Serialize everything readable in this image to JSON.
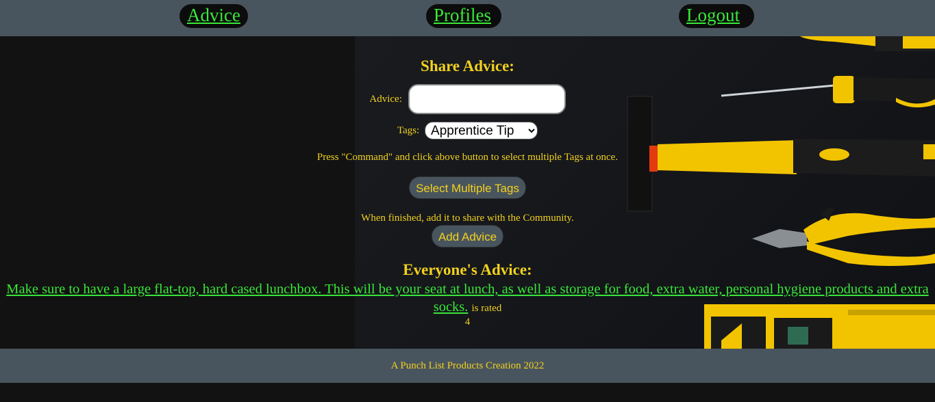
{
  "nav": {
    "advice": "Advice",
    "profiles": "Profiles",
    "logout": "Logout"
  },
  "share": {
    "title": "Share Advice:",
    "advice_label": "Advice:",
    "advice_value": "",
    "tags_label": "Tags:",
    "tags_selected": "Apprentice Tip",
    "hint": "Press \"Command\" and click above button to select multiple Tags at once.",
    "multi_button": "Select Multiple Tags",
    "finish_text": "When finished, add it to share with the Community.",
    "add_button": "Add Advice"
  },
  "everyone": {
    "title": "Everyone's Advice:",
    "items": [
      {
        "text": "Make sure to have a large flat-top, hard cased lunchbox. This will be your seat at lunch, as well as storage for food, extra water, personal hygiene products and extra socks.",
        "rated_label": "is rated",
        "rating": "4"
      }
    ]
  },
  "footer": {
    "text": "A Punch List Products Creation 2022"
  },
  "colors": {
    "nav_bg": "#49555e",
    "page_bg": "#121212",
    "accent_yellow": "#f2d11f",
    "link_green": "#39e839"
  }
}
